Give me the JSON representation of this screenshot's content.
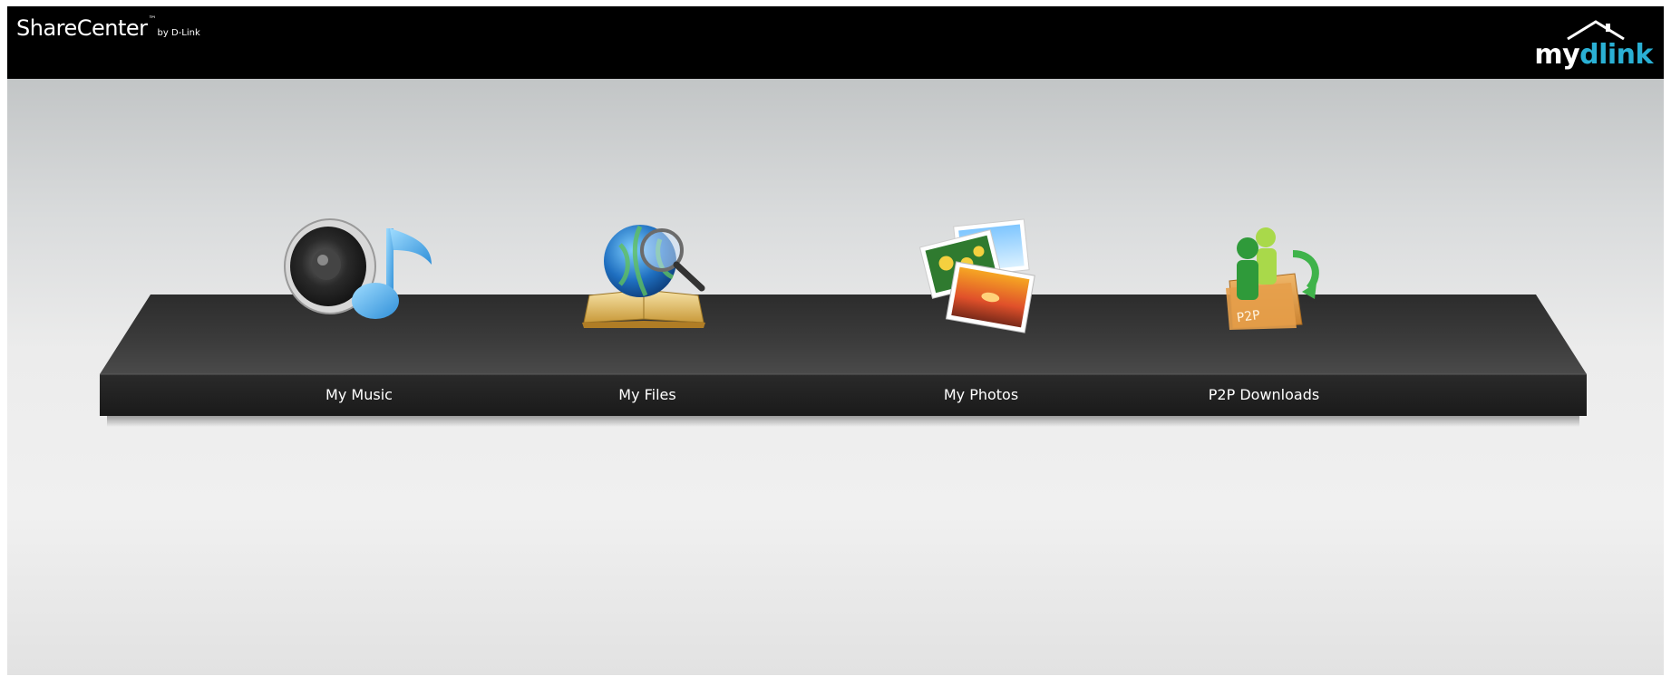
{
  "header": {
    "brand": {
      "name": "ShareCenter",
      "tm": "™",
      "by": "by D-Link"
    },
    "logo": {
      "my": "my",
      "dlink": "dlink"
    }
  },
  "apps": [
    {
      "label": "My Music",
      "icon": "music-speaker-icon"
    },
    {
      "label": "My Files",
      "icon": "globe-book-magnifier-icon"
    },
    {
      "label": "My Photos",
      "icon": "photo-stack-icon"
    },
    {
      "label": "P2P Downloads",
      "icon": "p2p-users-icon",
      "badge": "P2P"
    }
  ],
  "colors": {
    "header_bg": "#000000",
    "shelf_top": "#3e3e3e",
    "shelf_front": "#222222",
    "logo_accent": "#2ab0d4"
  }
}
